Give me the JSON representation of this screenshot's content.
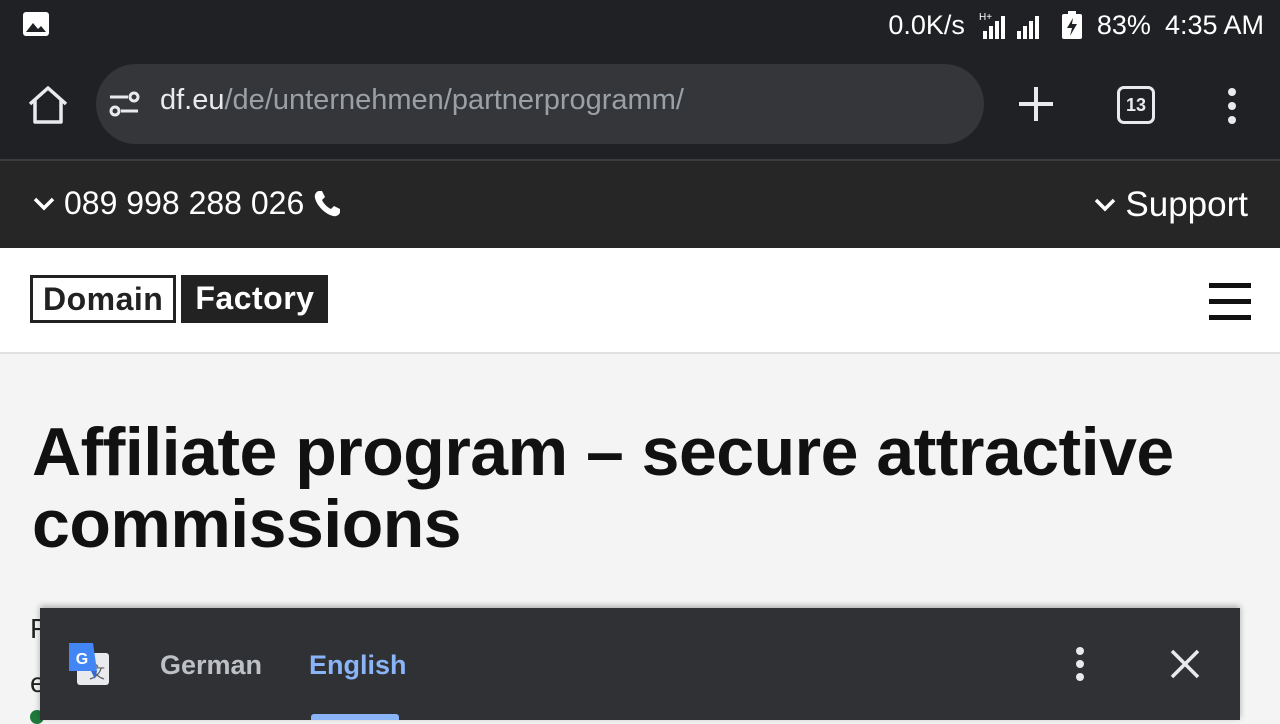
{
  "status_bar": {
    "net_speed": "0.0K/s",
    "network_type": "H+",
    "battery": "83%",
    "time": "4:35 AM"
  },
  "browser": {
    "url_host": "df.eu",
    "url_path": "/de/unternehmen/partnerprogramm/",
    "tab_count": "13"
  },
  "site": {
    "phone": "089 998 288 026",
    "support_label": "Support",
    "logo_part1": "Domain",
    "logo_part2": "Factory"
  },
  "main": {
    "title": "Affiliate program – secure attractive commissions",
    "para_peek_line1": "F",
    "para_peek_line2": "e"
  },
  "translate_bar": {
    "source_lang": "German",
    "target_lang": "English"
  },
  "colors": {
    "browser_bg": "#202124",
    "omnibox_bg": "#35363a",
    "site_strip_bg": "#262626",
    "translate_accent": "#8ab4f8"
  }
}
